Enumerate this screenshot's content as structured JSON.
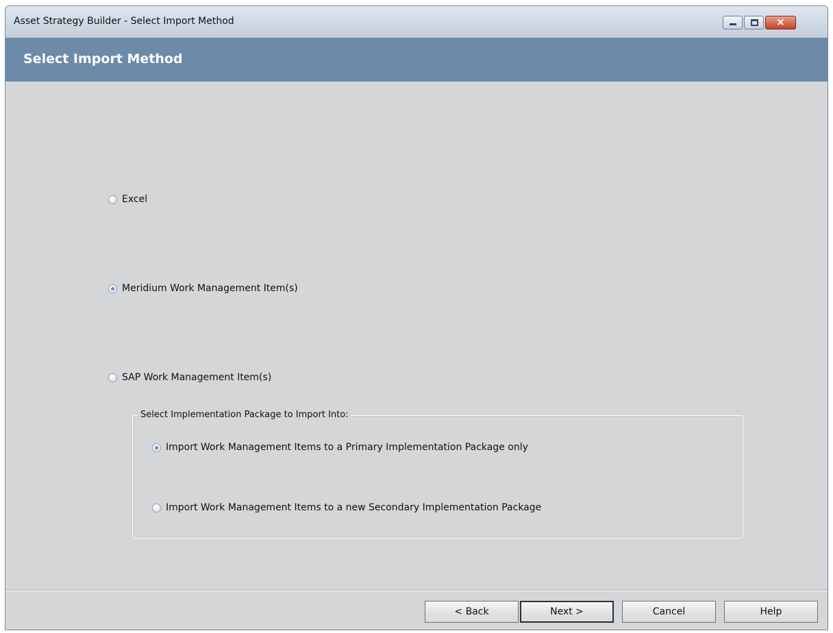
{
  "window": {
    "title": "Asset Strategy Builder - Select Import Method",
    "controls": {
      "minimize": "minimize",
      "maximize": "maximize",
      "close": "×"
    }
  },
  "header": {
    "title": "Select Import Method"
  },
  "import_methods": {
    "selected": "Meridium Work Management Item(s)",
    "options": [
      {
        "label": "Excel",
        "checked": false
      },
      {
        "label": "Meridium Work Management Item(s)",
        "checked": true
      },
      {
        "label": "SAP Work Management Item(s)",
        "checked": false
      }
    ]
  },
  "implementation_package": {
    "legend": "Select Implementation Package to Import Into:",
    "options": [
      {
        "label": "Import Work Management Items to a Primary Implementation Package only",
        "checked": true
      },
      {
        "label": "Import Work Management Items to a new Secondary Implementation Package",
        "checked": false
      }
    ]
  },
  "buttons": {
    "back": "< Back",
    "next": "Next >",
    "cancel": "Cancel",
    "help": "Help"
  }
}
